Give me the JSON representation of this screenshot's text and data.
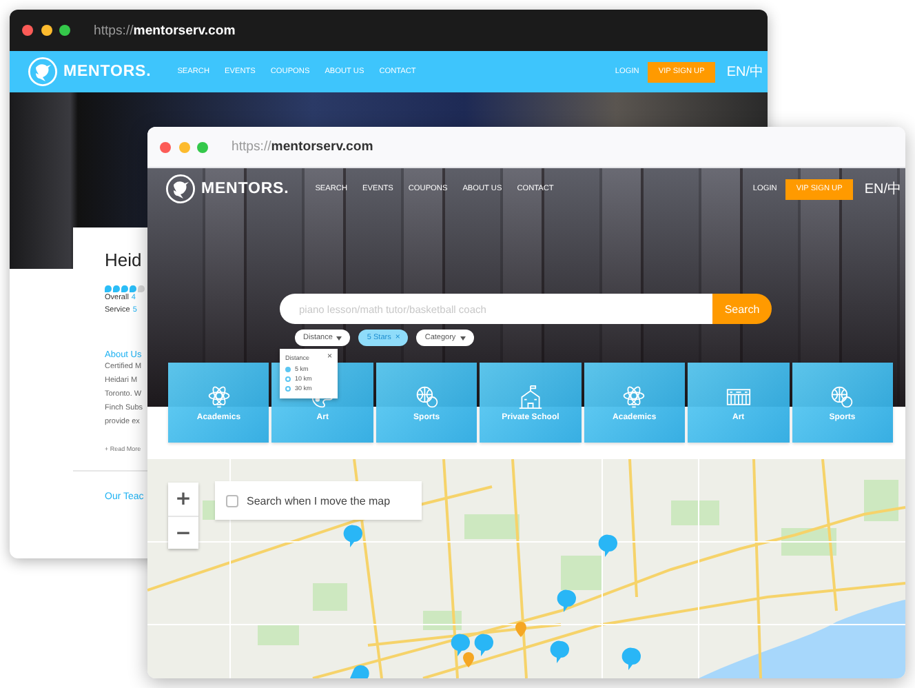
{
  "back_window": {
    "url": "https://**mentorserv.com**",
    "nav": {
      "logo": "MENTORS.",
      "links": [
        "SEARCH",
        "EVENTS",
        "COUPONS",
        "ABOUT US",
        "CONTACT"
      ],
      "login": "LOGIN",
      "signup": "VIP SIGN UP",
      "language": "EN/中"
    },
    "profile": {
      "name": "Heid",
      "stars": 4,
      "ratings": [
        {
          "label": "Overall",
          "value": "4"
        },
        {
          "label": "Service",
          "value": "5"
        }
      ],
      "about_heading": "About Us",
      "about_lines": [
        "Certified M",
        "Heidari M",
        "Toronto. W",
        "Finch Subs",
        "provide ex"
      ],
      "read_more": "+ Read More",
      "teachers_heading": "Our Teac"
    }
  },
  "front_window": {
    "url": "https://**mentorserv.com**",
    "nav": {
      "logo": "MENTORS.",
      "links": [
        "SEARCH",
        "EVENTS",
        "COUPONS",
        "ABOUT US",
        "CONTACT"
      ],
      "login": "LOGIN",
      "signup": "VIP SIGN UP",
      "language": "EN/中"
    },
    "search": {
      "placeholder": "piano lesson/math tutor/basketball coach",
      "button": "Search"
    },
    "filters": [
      {
        "label": "Distance",
        "kind": "dropdown",
        "selected": false
      },
      {
        "label": "5 Stars",
        "kind": "removable",
        "remove": "×",
        "selected": true
      },
      {
        "label": "Category",
        "kind": "dropdown",
        "selected": false
      }
    ],
    "distance_popup": {
      "title": "Distance",
      "close": "×",
      "options": [
        {
          "label": "5 km",
          "selected": true
        },
        {
          "label": "10 km",
          "selected": false
        },
        {
          "label": "30 km",
          "selected": false
        }
      ]
    },
    "categories": [
      {
        "label": "Academics",
        "kind": "atom"
      },
      {
        "label": "Art",
        "kind": "palette"
      },
      {
        "label": "Sports",
        "kind": "balls"
      },
      {
        "label": "Private School",
        "kind": "school"
      },
      {
        "label": "Academics",
        "kind": "atom"
      },
      {
        "label": "Art",
        "kind": "keyboard"
      },
      {
        "label": "Sports",
        "kind": "balls"
      }
    ],
    "map": {
      "zoom_in": "+",
      "zoom_out": "−",
      "search_on_move": {
        "label": "Search when I move the map",
        "checked": false
      }
    }
  }
}
